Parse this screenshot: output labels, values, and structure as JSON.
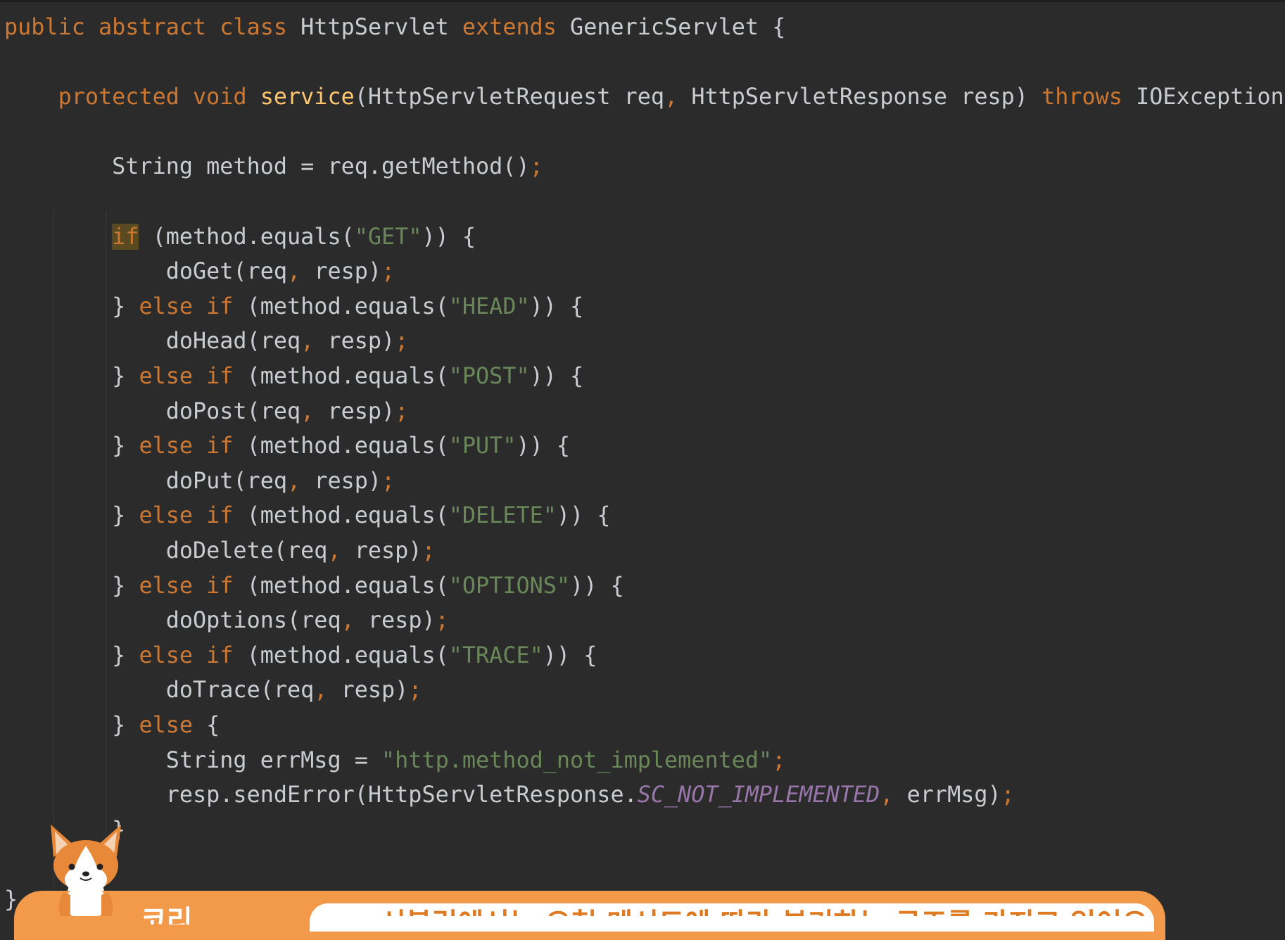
{
  "editor": {
    "lines": [
      [
        [
          "kw",
          "public abstract class "
        ],
        [
          "plain",
          "HttpServlet "
        ],
        [
          "kw",
          "extends "
        ],
        [
          "plain",
          "GenericServlet {"
        ]
      ],
      [],
      [
        [
          "plain",
          "    "
        ],
        [
          "kw",
          "protected void "
        ],
        [
          "fn",
          "service"
        ],
        [
          "plain",
          "(HttpServletRequest req"
        ],
        [
          "punc",
          ", "
        ],
        [
          "plain",
          "HttpServletResponse resp) "
        ],
        [
          "kw",
          "throws "
        ],
        [
          "plain",
          "IOException {"
        ]
      ],
      [],
      [
        [
          "plain",
          "        String method = req.getMethod()"
        ],
        [
          "punc",
          ";"
        ]
      ],
      [],
      [
        [
          "plain",
          "        "
        ],
        [
          "kw hl",
          "if"
        ],
        [
          "plain",
          " (method.equals("
        ],
        [
          "str",
          "\"GET\""
        ],
        [
          "plain",
          ")) {"
        ]
      ],
      [
        [
          "plain",
          "            doGet(req"
        ],
        [
          "punc",
          ", "
        ],
        [
          "plain",
          "resp)"
        ],
        [
          "punc",
          ";"
        ]
      ],
      [
        [
          "plain",
          "        } "
        ],
        [
          "kw",
          "else if "
        ],
        [
          "plain",
          "(method.equals("
        ],
        [
          "str",
          "\"HEAD\""
        ],
        [
          "plain",
          ")) {"
        ]
      ],
      [
        [
          "plain",
          "            doHead(req"
        ],
        [
          "punc",
          ", "
        ],
        [
          "plain",
          "resp)"
        ],
        [
          "punc",
          ";"
        ]
      ],
      [
        [
          "plain",
          "        } "
        ],
        [
          "kw",
          "else if "
        ],
        [
          "plain",
          "(method.equals("
        ],
        [
          "str",
          "\"POST\""
        ],
        [
          "plain",
          ")) {"
        ]
      ],
      [
        [
          "plain",
          "            doPost(req"
        ],
        [
          "punc",
          ", "
        ],
        [
          "plain",
          "resp)"
        ],
        [
          "punc",
          ";"
        ]
      ],
      [
        [
          "plain",
          "        } "
        ],
        [
          "kw",
          "else if "
        ],
        [
          "plain",
          "(method.equals("
        ],
        [
          "str",
          "\"PUT\""
        ],
        [
          "plain",
          ")) {"
        ]
      ],
      [
        [
          "plain",
          "            doPut(req"
        ],
        [
          "punc",
          ", "
        ],
        [
          "plain",
          "resp)"
        ],
        [
          "punc",
          ";"
        ]
      ],
      [
        [
          "plain",
          "        } "
        ],
        [
          "kw",
          "else if "
        ],
        [
          "plain",
          "(method.equals("
        ],
        [
          "str",
          "\"DELETE\""
        ],
        [
          "plain",
          ")) {"
        ]
      ],
      [
        [
          "plain",
          "            doDelete(req"
        ],
        [
          "punc",
          ", "
        ],
        [
          "plain",
          "resp)"
        ],
        [
          "punc",
          ";"
        ]
      ],
      [
        [
          "plain",
          "        } "
        ],
        [
          "kw",
          "else if "
        ],
        [
          "plain",
          "(method.equals("
        ],
        [
          "str",
          "\"OPTIONS\""
        ],
        [
          "plain",
          ")) {"
        ]
      ],
      [
        [
          "plain",
          "            doOptions(req"
        ],
        [
          "punc",
          ", "
        ],
        [
          "plain",
          "resp)"
        ],
        [
          "punc",
          ";"
        ]
      ],
      [
        [
          "plain",
          "        } "
        ],
        [
          "kw",
          "else if "
        ],
        [
          "plain",
          "(method.equals("
        ],
        [
          "str",
          "\"TRACE\""
        ],
        [
          "plain",
          ")) {"
        ]
      ],
      [
        [
          "plain",
          "            doTrace(req"
        ],
        [
          "punc",
          ", "
        ],
        [
          "plain",
          "resp)"
        ],
        [
          "punc",
          ";"
        ]
      ],
      [
        [
          "plain",
          "        } "
        ],
        [
          "kw",
          "else "
        ],
        [
          "plain",
          "{"
        ]
      ],
      [
        [
          "plain",
          "            String errMsg = "
        ],
        [
          "str",
          "\"http.method_not_implemented\""
        ],
        [
          "punc",
          ";"
        ]
      ],
      [
        [
          "plain",
          "            resp.sendError(HttpServletResponse."
        ],
        [
          "const",
          "SC_NOT_IMPLEMENTED"
        ],
        [
          "punc",
          ", "
        ],
        [
          "plain",
          "errMsg)"
        ],
        [
          "punc",
          ";"
        ]
      ],
      [
        [
          "plain",
          "        }"
        ]
      ],
      [],
      [
        [
          "plain",
          "}"
        ]
      ]
    ]
  },
  "caption": {
    "speaker": "코리",
    "text": "서블릿에서는 요청 메서드에 따라 분기하는 구조를 가지고 있어요"
  },
  "colors": {
    "background": "#2b2b2b",
    "keyword": "#cc7832",
    "function": "#ffc66d",
    "string": "#6a8759",
    "constant": "#9876aa",
    "text": "#c9ccd1",
    "caption_accent": "#f2994a"
  }
}
